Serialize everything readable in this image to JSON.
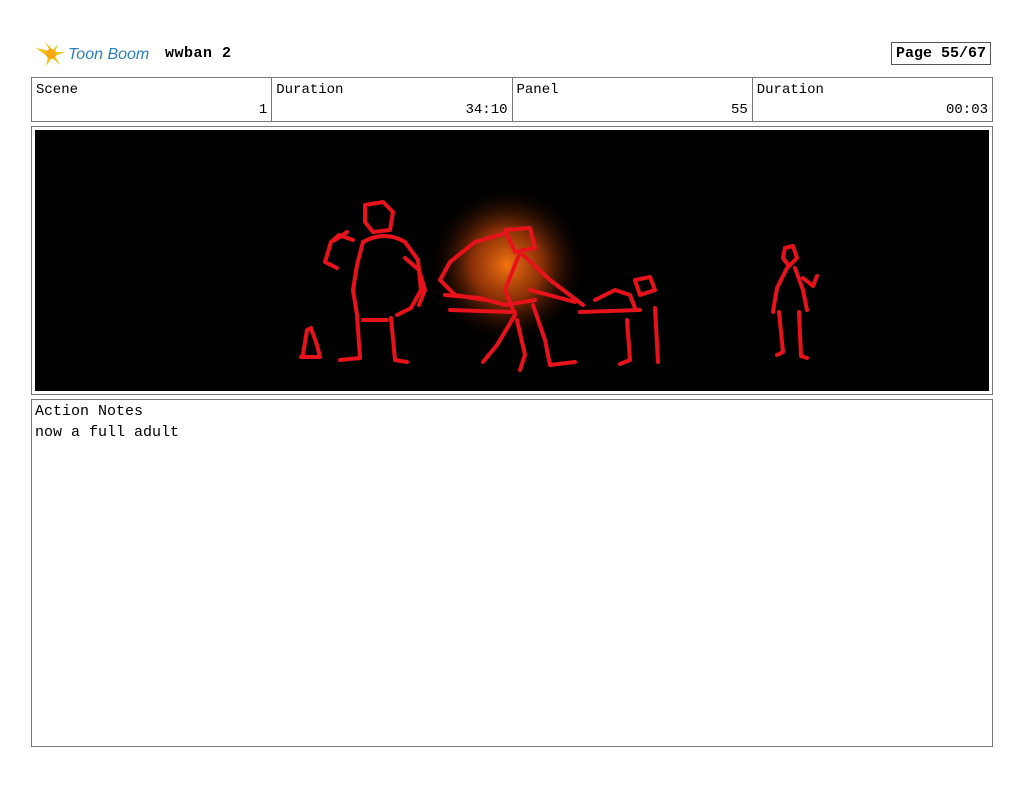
{
  "header": {
    "logo_text": "Toon Boom",
    "project_name": "wwban 2",
    "page_indicator": "Page 55/67"
  },
  "info": {
    "scene_label": "Scene",
    "scene_value": "1",
    "scene_duration_label": "Duration",
    "scene_duration_value": "34:10",
    "panel_label": "Panel",
    "panel_value": "55",
    "panel_duration_label": "Duration",
    "panel_duration_value": "00:03"
  },
  "notes": {
    "label": "Action Notes",
    "text": "now a full adult"
  },
  "colors": {
    "sketch": "#e8121a",
    "glow": "#ff7a12",
    "logo_yellow": "#f2c21b",
    "logo_text": "#2d7fc1"
  }
}
